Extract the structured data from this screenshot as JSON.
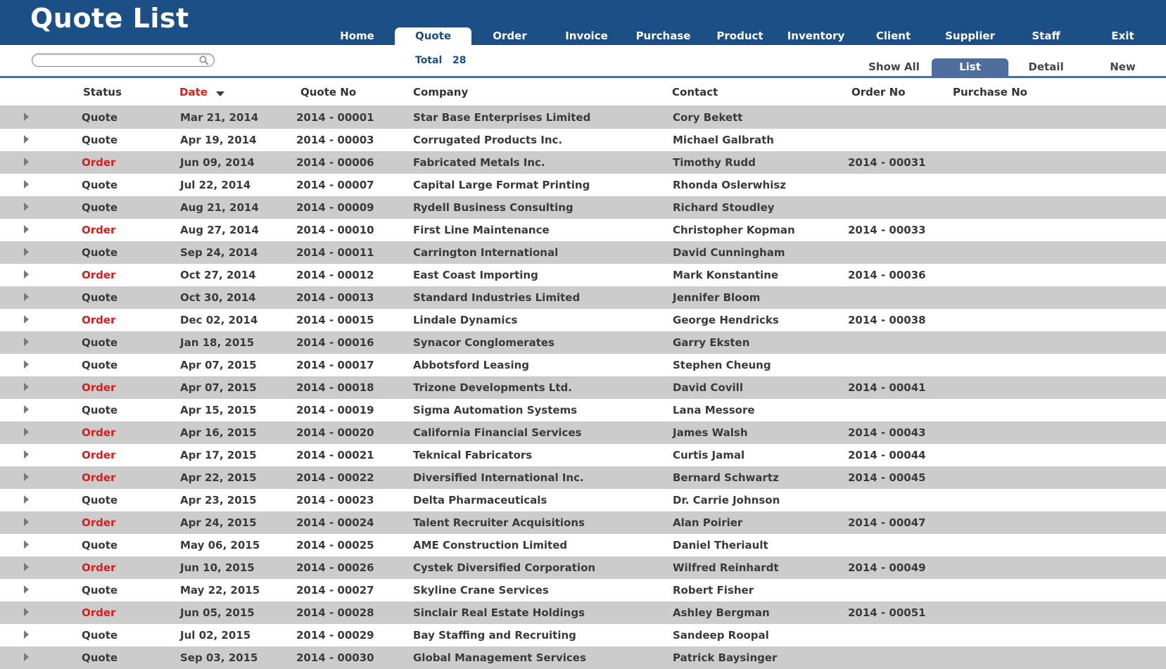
{
  "app": {
    "title": "Quote List",
    "accent": "#1b4f85",
    "order_status_color": "#e01b1b",
    "stripe_color": "#cccccc"
  },
  "nav": {
    "tabs": [
      {
        "label": "Home",
        "active": false
      },
      {
        "label": "Quote",
        "active": true
      },
      {
        "label": "Order",
        "active": false
      },
      {
        "label": "Invoice",
        "active": false
      },
      {
        "label": "Purchase",
        "active": false
      },
      {
        "label": "Product",
        "active": false
      },
      {
        "label": "Inventory",
        "active": false
      },
      {
        "label": "Client",
        "active": false
      },
      {
        "label": "Supplier",
        "active": false
      },
      {
        "label": "Staff",
        "active": false
      },
      {
        "label": "Exit",
        "active": false
      }
    ]
  },
  "search": {
    "value": "",
    "placeholder": "",
    "icon": "search-icon"
  },
  "total": {
    "label": "Total",
    "value": "28"
  },
  "view_tabs": [
    {
      "label": "Show All",
      "active": false
    },
    {
      "label": "List",
      "active": true
    },
    {
      "label": "Detail",
      "active": false
    },
    {
      "label": "New",
      "active": false
    }
  ],
  "table": {
    "columns": {
      "status": "Status",
      "date": "Date",
      "quote_no": "Quote No",
      "company": "Company",
      "contact": "Contact",
      "order_no": "Order No",
      "purchase_no": "Purchase No"
    },
    "sort": {
      "column": "Date",
      "direction": "descending",
      "icon": "sort-down-icon"
    },
    "rows": [
      {
        "status": "Quote",
        "date": "Mar 21, 2014",
        "quote_no": "2014 - 00001",
        "company": "Star Base Enterprises Limited",
        "contact": "Cory Bekett",
        "order_no": "",
        "purchase_no": ""
      },
      {
        "status": "Quote",
        "date": "Apr 19, 2014",
        "quote_no": "2014 - 00003",
        "company": "Corrugated Products Inc.",
        "contact": "Michael Galbrath",
        "order_no": "",
        "purchase_no": ""
      },
      {
        "status": "Order",
        "date": "Jun 09, 2014",
        "quote_no": "2014 - 00006",
        "company": "Fabricated Metals Inc.",
        "contact": "Timothy Rudd",
        "order_no": "2014 - 00031",
        "purchase_no": ""
      },
      {
        "status": "Quote",
        "date": "Jul 22, 2014",
        "quote_no": "2014 - 00007",
        "company": "Capital Large Format Printing",
        "contact": "Rhonda Oslerwhisz",
        "order_no": "",
        "purchase_no": ""
      },
      {
        "status": "Quote",
        "date": "Aug 21, 2014",
        "quote_no": "2014 - 00009",
        "company": "Rydell Business Consulting",
        "contact": "Richard Stoudley",
        "order_no": "",
        "purchase_no": ""
      },
      {
        "status": "Order",
        "date": "Aug 27, 2014",
        "quote_no": "2014 - 00010",
        "company": "First Line Maintenance",
        "contact": "Christopher Kopman",
        "order_no": "2014 - 00033",
        "purchase_no": ""
      },
      {
        "status": "Quote",
        "date": "Sep 24, 2014",
        "quote_no": "2014 - 00011",
        "company": "Carrington International",
        "contact": "David Cunningham",
        "order_no": "",
        "purchase_no": ""
      },
      {
        "status": "Order",
        "date": "Oct 27, 2014",
        "quote_no": "2014 - 00012",
        "company": "East Coast Importing",
        "contact": "Mark Konstantine",
        "order_no": "2014 - 00036",
        "purchase_no": ""
      },
      {
        "status": "Quote",
        "date": "Oct 30, 2014",
        "quote_no": "2014 - 00013",
        "company": "Standard Industries Limited",
        "contact": "Jennifer Bloom",
        "order_no": "",
        "purchase_no": ""
      },
      {
        "status": "Order",
        "date": "Dec 02, 2014",
        "quote_no": "2014 - 00015",
        "company": "Lindale Dynamics",
        "contact": "George Hendricks",
        "order_no": "2014 - 00038",
        "purchase_no": ""
      },
      {
        "status": "Quote",
        "date": "Jan 18, 2015",
        "quote_no": "2014 - 00016",
        "company": "Synacor Conglomerates",
        "contact": "Garry Eksten",
        "order_no": "",
        "purchase_no": ""
      },
      {
        "status": "Quote",
        "date": "Apr 07, 2015",
        "quote_no": "2014 - 00017",
        "company": "Abbotsford Leasing",
        "contact": "Stephen Cheung",
        "order_no": "",
        "purchase_no": ""
      },
      {
        "status": "Order",
        "date": "Apr 07, 2015",
        "quote_no": "2014 - 00018",
        "company": "Trizone Developments Ltd.",
        "contact": "David Covill",
        "order_no": "2014 - 00041",
        "purchase_no": ""
      },
      {
        "status": "Quote",
        "date": "Apr 15, 2015",
        "quote_no": "2014 - 00019",
        "company": "Sigma Automation Systems",
        "contact": "Lana Messore",
        "order_no": "",
        "purchase_no": ""
      },
      {
        "status": "Order",
        "date": "Apr 16, 2015",
        "quote_no": "2014 - 00020",
        "company": "California Financial Services",
        "contact": "James Walsh",
        "order_no": "2014 - 00043",
        "purchase_no": ""
      },
      {
        "status": "Order",
        "date": "Apr 17, 2015",
        "quote_no": "2014 - 00021",
        "company": "Teknical Fabricators",
        "contact": "Curtis Jamal",
        "order_no": "2014 - 00044",
        "purchase_no": ""
      },
      {
        "status": "Order",
        "date": "Apr 22, 2015",
        "quote_no": "2014 - 00022",
        "company": "Diversified International Inc.",
        "contact": "Bernard Schwartz",
        "order_no": "2014 - 00045",
        "purchase_no": ""
      },
      {
        "status": "Quote",
        "date": "Apr 23, 2015",
        "quote_no": "2014 - 00023",
        "company": "Delta Pharmaceuticals",
        "contact": "Dr. Carrie Johnson",
        "order_no": "",
        "purchase_no": ""
      },
      {
        "status": "Order",
        "date": "Apr 24, 2015",
        "quote_no": "2014 - 00024",
        "company": "Talent Recruiter Acquisitions",
        "contact": "Alan Poirier",
        "order_no": "2014 - 00047",
        "purchase_no": ""
      },
      {
        "status": "Quote",
        "date": "May 06, 2015",
        "quote_no": "2014 - 00025",
        "company": "AME Construction Limited",
        "contact": "Daniel Theriault",
        "order_no": "",
        "purchase_no": ""
      },
      {
        "status": "Order",
        "date": "Jun 10, 2015",
        "quote_no": "2014 - 00026",
        "company": "Cystek Diversified Corporation",
        "contact": "Wilfred Reinhardt",
        "order_no": "2014 - 00049",
        "purchase_no": ""
      },
      {
        "status": "Quote",
        "date": "May 22, 2015",
        "quote_no": "2014 - 00027",
        "company": "Skyline Crane Services",
        "contact": "Robert Fisher",
        "order_no": "",
        "purchase_no": ""
      },
      {
        "status": "Order",
        "date": "Jun 05, 2015",
        "quote_no": "2014 - 00028",
        "company": "Sinclair Real Estate Holdings",
        "contact": "Ashley Bergman",
        "order_no": "2014 - 00051",
        "purchase_no": ""
      },
      {
        "status": "Quote",
        "date": "Jul 02, 2015",
        "quote_no": "2014 - 00029",
        "company": "Bay Staffing and Recruiting",
        "contact": "Sandeep Roopal",
        "order_no": "",
        "purchase_no": ""
      },
      {
        "status": "Quote",
        "date": "Sep 03, 2015",
        "quote_no": "2014 - 00030",
        "company": "Global Management Services",
        "contact": "Patrick Baysinger",
        "order_no": "",
        "purchase_no": ""
      }
    ]
  }
}
